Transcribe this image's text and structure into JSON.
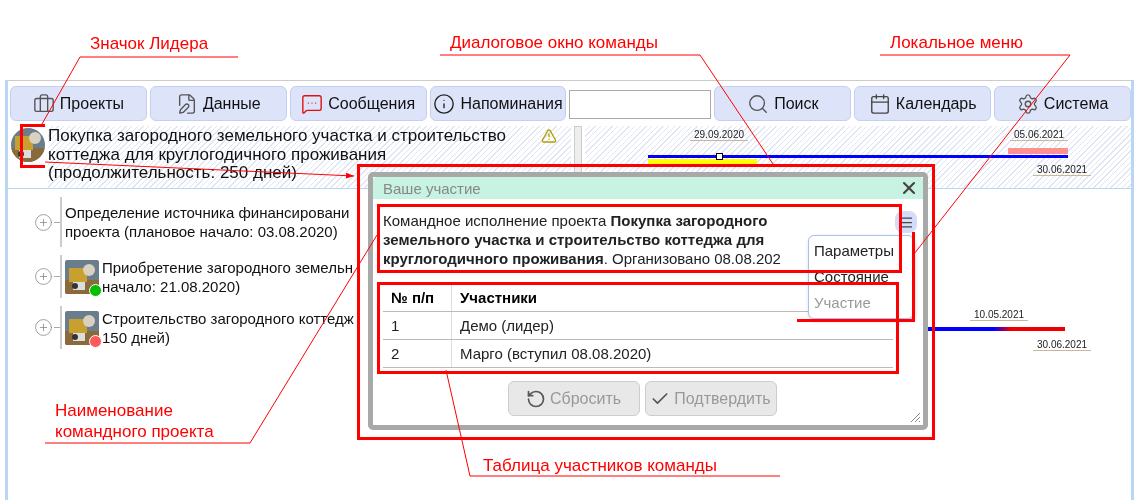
{
  "toolbar": [
    {
      "kind": "button",
      "label": "Проекты"
    },
    {
      "kind": "button",
      "label": "Данные"
    },
    {
      "kind": "button",
      "label": "Сообщения"
    },
    {
      "kind": "button",
      "label": "Напоминания"
    },
    {
      "kind": "search"
    },
    {
      "kind": "button",
      "label": "Поиск"
    },
    {
      "kind": "button",
      "label": "Календарь"
    },
    {
      "kind": "button",
      "label": "Система"
    }
  ],
  "project": {
    "title": "Покупка загородного земельного участка и строительство коттеджа для круглогодичного проживания (продолжительность: 250 дней)",
    "warning": true,
    "level": 0.26,
    "dates": [
      "29.09.2020",
      "05.06.2021",
      "30.06.2021"
    ]
  },
  "tasks": [
    {
      "lines": [
        "Определение источника финансировани",
        "проекта (плановое начало: 03.08.2020)"
      ],
      "kind": "plain"
    },
    {
      "lines": [
        "Приобретение загородного земельн",
        "начало: 21.08.2020)"
      ],
      "kind": "picture",
      "color": "#00c000"
    },
    {
      "lines": [
        "Строительство загородного коттедж",
        "150 дней)"
      ],
      "kind": "picture",
      "color": "#ff5a5a",
      "dates": [
        "10.05.2021",
        "30.06.2021"
      ]
    }
  ],
  "dialog": {
    "title": "Ваше участие",
    "text": "Командное исполнение проекта **Покупка загородного земельного участка и строительство коттеджа для круглогодичного проживания**. Организовано 08.08.202",
    "menu": [
      {
        "label": "Параметры",
        "disabled": false
      },
      {
        "label": "Состояние",
        "disabled": false
      },
      {
        "label": "Участие",
        "disabled": true
      }
    ],
    "table": {
      "columns": [
        "№ п/п",
        "Участники"
      ],
      "rows": [
        [
          "1",
          "Демо (лидер)"
        ],
        [
          "2",
          "Марго (вступил 08.08.2020)"
        ]
      ]
    },
    "buttons": [
      {
        "label": "Сбросить",
        "disabled": true
      },
      {
        "label": "Подтвердить",
        "disabled": true
      }
    ]
  },
  "callouts": [
    {
      "label": "Значок Лидера"
    },
    {
      "label": "Диалоговое окно команды"
    },
    {
      "label": "Локальное меню"
    },
    {
      "label": "Наименование командного проекта"
    },
    {
      "label": "Таблица участников команды"
    }
  ]
}
